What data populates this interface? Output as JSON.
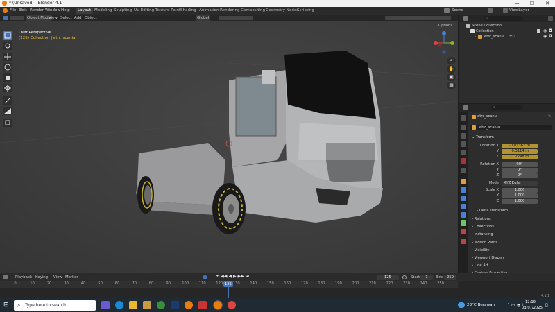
{
  "window": {
    "title": "* (Unsaved) - Blender 4.1",
    "minimize": "—",
    "maximize": "☐",
    "close": "✕"
  },
  "menu": [
    "File",
    "Edit",
    "Render",
    "Window",
    "Help"
  ],
  "workspaces": [
    "Layout",
    "Modeling",
    "Sculpting",
    "UV Editing",
    "Texture Paint",
    "Shading",
    "Animation",
    "Rendering",
    "Compositing",
    "Geometry Nodes",
    "Scripting"
  ],
  "workspace_add": "+",
  "scene": {
    "label": "Scene",
    "view_layer": "ViewLayer"
  },
  "viewport_header": {
    "mode": "Object Mode",
    "items": [
      "View",
      "Select",
      "Add",
      "Object"
    ],
    "transform": "Global",
    "options": "Options"
  },
  "overlay": {
    "perspective": "User Perspective",
    "collection_info": "(125) Collection | etrc_scania"
  },
  "gizmo": {
    "axes": [
      "X",
      "Y",
      "Z"
    ]
  },
  "outliner": {
    "root": "Scene Collection",
    "collection": "Collection",
    "object": "etrc_scania",
    "search_placeholder": "⌕"
  },
  "properties": {
    "search_placeholder": "⌕",
    "object_name": "etrc_scania",
    "data_name": "etrc_scania",
    "section_transform": "Transform",
    "location": {
      "label": "Location X",
      "x": "-0.01367 m",
      "y_label": "Y",
      "y": "-0.3114 m",
      "z_label": "Z",
      "z": "-1.2248 m"
    },
    "rotation": {
      "label": "Rotation X",
      "x": "90°",
      "y_label": "Y",
      "y": "0°",
      "z_label": "Z",
      "z": "0°"
    },
    "mode": {
      "label": "Mode",
      "value": "XYZ Euler"
    },
    "scale": {
      "label": "Scale X",
      "x": "1.000",
      "y_label": "Y",
      "y": "1.000",
      "z_label": "Z",
      "z": "1.000"
    },
    "delta": "Delta Transform",
    "sections": [
      "Relations",
      "Collections",
      "Instancing",
      "Motion Paths",
      "Visibility",
      "Viewport Display",
      "Line Art",
      "Custom Properties"
    ]
  },
  "timeline": {
    "menu": [
      "Playback",
      "Keying",
      "View",
      "Marker"
    ],
    "current_frame": "125",
    "start_label": "Start",
    "start": "1",
    "end_label": "End",
    "end": "250",
    "ticks": [
      "0",
      "10",
      "20",
      "30",
      "40",
      "50",
      "60",
      "70",
      "80",
      "90",
      "100",
      "110",
      "120",
      "130",
      "140",
      "150",
      "160",
      "170",
      "180",
      "190",
      "200",
      "210",
      "220",
      "230",
      "240",
      "250"
    ],
    "playhead": "125",
    "version": "4.1.1"
  },
  "taskbar": {
    "search_placeholder": "Type here to search",
    "weather": "28°C  Berawan",
    "time": "12:19",
    "date": "03/07/2025"
  },
  "colors": {
    "accent": "#4772b3",
    "selected_text": "#f0c43b",
    "keyframe_field": "#b39330"
  }
}
